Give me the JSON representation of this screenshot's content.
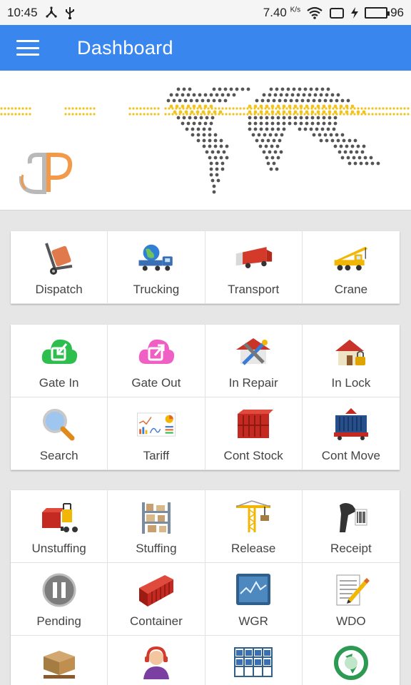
{
  "status_bar": {
    "time": "10:45",
    "speed": "7.40",
    "speed_unit": "K/s",
    "battery": "96",
    "battery_level": 0.96
  },
  "app_bar": {
    "title": "Dashboard",
    "menu_icon": "hamburger-menu-icon"
  },
  "colors": {
    "primary": "#3a86ef",
    "logo_orange": "#f39a4a",
    "map_dots": "#555555",
    "dot_band": "#f2c21d"
  },
  "sections": [
    {
      "tiles": [
        {
          "label": "Dispatch",
          "icon": "hand-truck-icon"
        },
        {
          "label": "Trucking",
          "icon": "globe-truck-icon"
        },
        {
          "label": "Transport",
          "icon": "moving-truck-icon"
        },
        {
          "label": "Crane",
          "icon": "crane-icon"
        }
      ]
    },
    {
      "tiles": [
        {
          "label": "Gate In",
          "icon": "cloud-arrow-in-icon"
        },
        {
          "label": "Gate Out",
          "icon": "cloud-arrow-out-icon"
        },
        {
          "label": "In Repair",
          "icon": "repair-tools-icon"
        },
        {
          "label": "In Lock",
          "icon": "house-lock-icon"
        },
        {
          "label": "Search",
          "icon": "magnifier-icon"
        },
        {
          "label": "Tariff",
          "icon": "charts-board-icon"
        },
        {
          "label": "Cont Stock",
          "icon": "container-stack-icon"
        },
        {
          "label": "Cont Move",
          "icon": "container-move-icon"
        }
      ]
    },
    {
      "tiles": [
        {
          "label": "Unstuffing",
          "icon": "forklift-icon"
        },
        {
          "label": "Stuffing",
          "icon": "warehouse-shelf-icon"
        },
        {
          "label": "Release",
          "icon": "tower-crane-icon"
        },
        {
          "label": "Receipt",
          "icon": "barcode-scanner-icon"
        },
        {
          "label": "Pending",
          "icon": "pause-icon"
        },
        {
          "label": "Container",
          "icon": "container-icon"
        },
        {
          "label": "WGR",
          "icon": "monitor-graph-icon"
        },
        {
          "label": "WDO",
          "icon": "document-edit-icon"
        },
        {
          "label": "",
          "icon": "pallet-boxes-icon"
        },
        {
          "label": "",
          "icon": "support-agent-icon"
        },
        {
          "label": "",
          "icon": "storage-rack-icon"
        },
        {
          "label": "",
          "icon": "recycle-globe-icon"
        }
      ]
    }
  ]
}
